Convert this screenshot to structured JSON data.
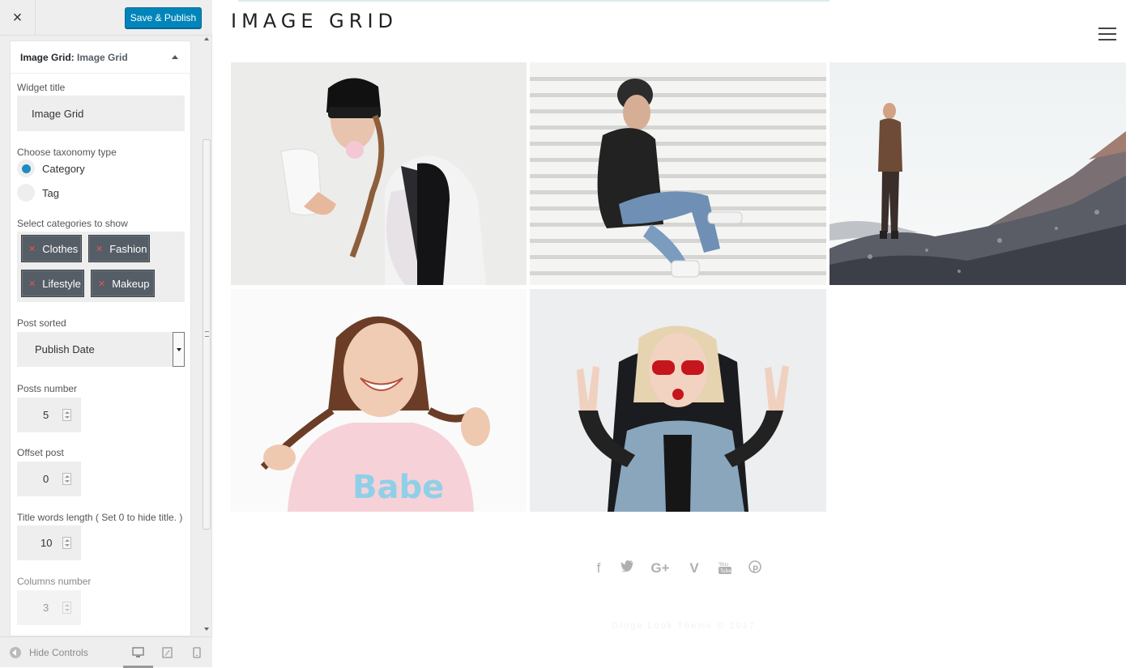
{
  "topbar": {
    "close_icon": "×",
    "save_label": "Save & Publish"
  },
  "section": {
    "prefix": "Image Grid:",
    "name": "Image Grid"
  },
  "widget_title": {
    "label": "Widget title",
    "value": "Image Grid"
  },
  "taxonomy": {
    "label": "Choose taxonomy type",
    "options": [
      "Category",
      "Tag"
    ],
    "selected": "Category"
  },
  "categories": {
    "label": "Select categories to show",
    "tags": [
      "Clothes",
      "Fashion",
      "Lifestyle",
      "Makeup"
    ]
  },
  "post_sorted": {
    "label": "Post sorted",
    "value": "Publish Date"
  },
  "posts_number": {
    "label": "Posts number",
    "value": "5"
  },
  "offset_post": {
    "label": "Offset post",
    "value": "0"
  },
  "title_words": {
    "label": "Title words length ( Set 0 to hide title. )",
    "value": "10"
  },
  "columns_number": {
    "label": "Columns number",
    "value": "3"
  },
  "footer": {
    "hide_controls": "Hide Controls",
    "devices": [
      "desktop-icon",
      "tablet-icon",
      "mobile-icon"
    ]
  },
  "preview": {
    "site_title": "IMAGE GRID",
    "social": [
      {
        "name": "facebook-icon",
        "glyph": "f"
      },
      {
        "name": "twitter-icon",
        "glyph": "🐦"
      },
      {
        "name": "google-plus-icon",
        "glyph": "G+"
      },
      {
        "name": "vimeo-icon",
        "glyph": "V"
      },
      {
        "name": "youtube-icon",
        "glyph": "▶"
      },
      {
        "name": "pinterest-icon",
        "glyph": "P"
      }
    ],
    "copyright": "Gioga Look Theme © 2017"
  },
  "colors": {
    "accent": "#0085ba",
    "radio": "#1e8cbe",
    "tag_bg": "#555d66",
    "tag_x": "#e05555"
  }
}
